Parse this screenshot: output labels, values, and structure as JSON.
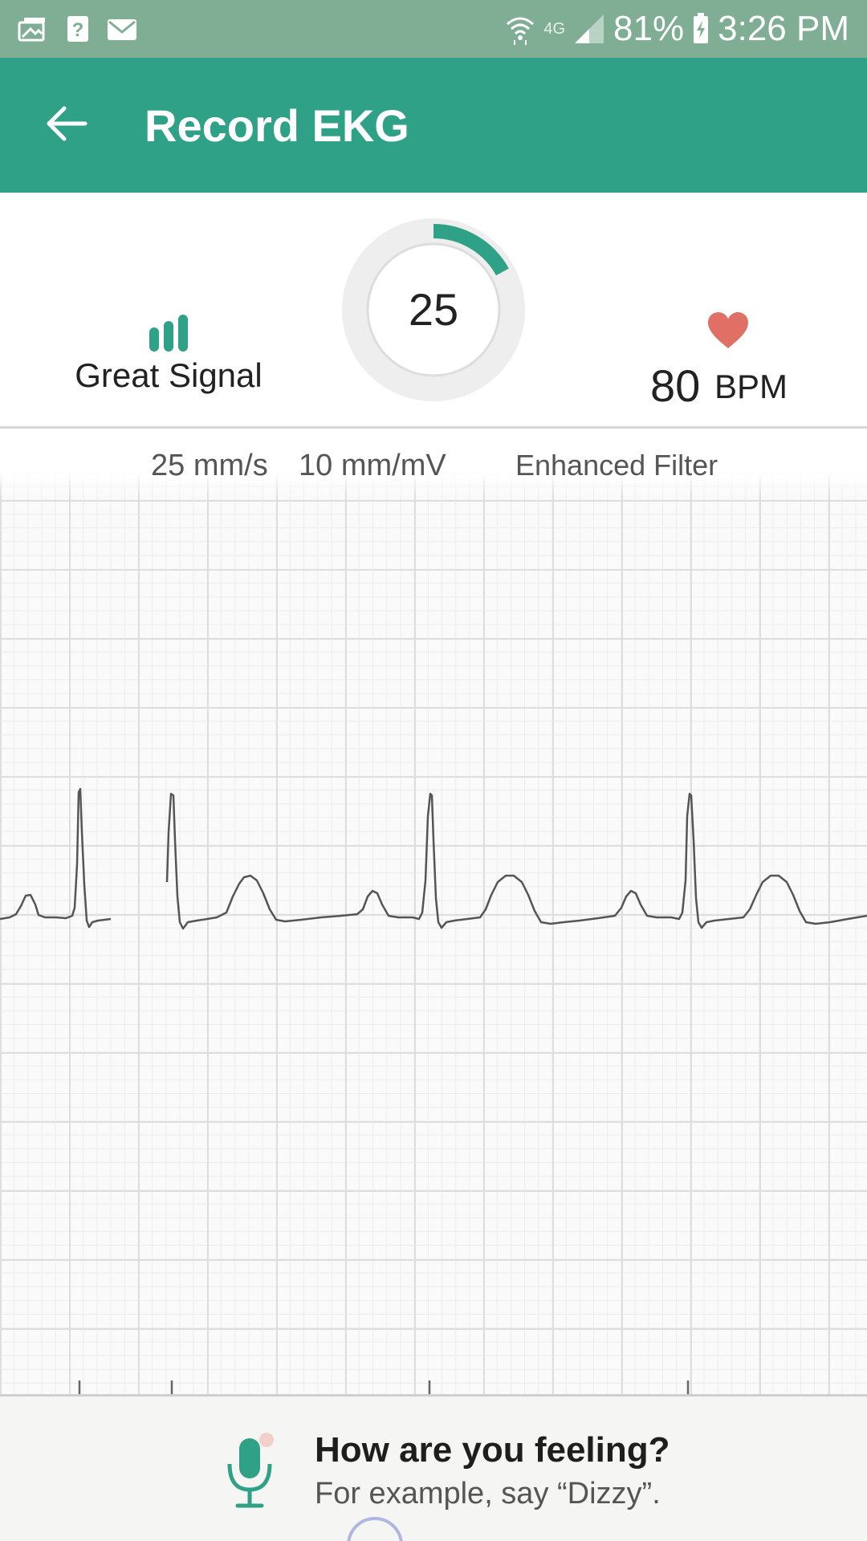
{
  "status_bar": {
    "left_icons": [
      "picture-mail-icon",
      "unknown-app-icon",
      "email-icon"
    ],
    "network": "4G",
    "battery": "81%",
    "time": "3:26 PM"
  },
  "app_bar": {
    "title": "Record EKG",
    "back_icon": "arrow-back-icon"
  },
  "header": {
    "signal_label": "Great Signal",
    "signal_icon": "signal-bars-icon",
    "timer_value": "25",
    "timer_progress": 0.17,
    "heart_rate": "80",
    "heart_rate_unit": "BPM",
    "heart_icon": "heart-icon"
  },
  "ekg": {
    "speed": "25 mm/s",
    "gain": "10 mm/mV",
    "filter": "Enhanced Filter"
  },
  "prompt": {
    "title": "How are you feeling?",
    "hint": "For example, say “Dizzy”.",
    "mic_icon": "microphone-icon"
  },
  "colors": {
    "status_bar": "#7fae94",
    "primary": "#2fa187",
    "heart": "#e06f66",
    "trace": "#555555"
  }
}
